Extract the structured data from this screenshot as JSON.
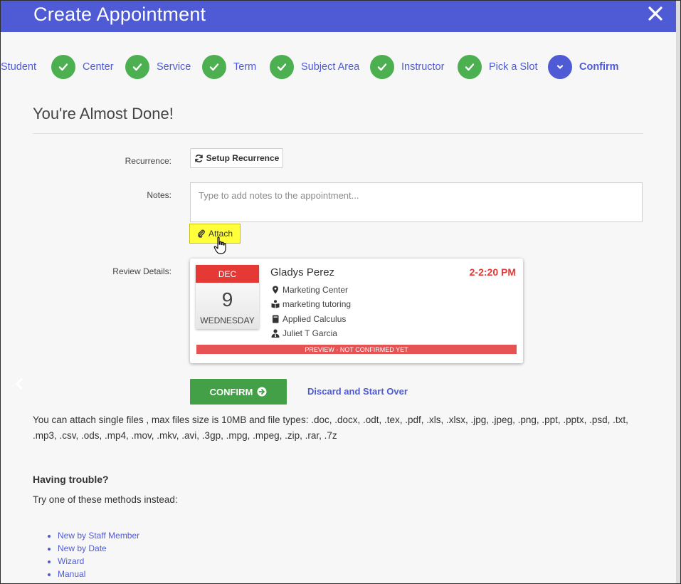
{
  "header": {
    "title": "Create Appointment"
  },
  "steps": [
    {
      "label": "Student",
      "done": true
    },
    {
      "label": "Center",
      "done": true
    },
    {
      "label": "Service",
      "done": true
    },
    {
      "label": "Term",
      "done": true
    },
    {
      "label": "Subject Area",
      "done": true
    },
    {
      "label": "Instructor",
      "done": true
    },
    {
      "label": "Pick a Slot",
      "done": true
    },
    {
      "label": "Confirm",
      "done": false,
      "active": true
    }
  ],
  "page_title": "You're Almost Done!",
  "form": {
    "recurrence_label": "Recurrence:",
    "recurrence_button": "Setup Recurrence",
    "notes_label": "Notes:",
    "notes_placeholder": "Type to add notes to the appointment...",
    "attach_button": "Attach",
    "review_label": "Review Details:"
  },
  "review": {
    "month": "DEC",
    "day": "9",
    "weekday": "WEDNESDAY",
    "name": "Gladys Perez",
    "time": "2-2:20 PM",
    "center": "Marketing Center",
    "service": "marketing tutoring",
    "subject": "Applied Calculus",
    "instructor": "Juliet T Garcia",
    "preview_text": "PREVIEW - NOT CONFIRMED YET"
  },
  "actions": {
    "confirm_label": "CONFIRM",
    "discard_label": "Discard and Start Over"
  },
  "info_text": "You can attach single files , max files size is 10MB and file types: .doc, .docx, .odt, .tex, .pdf, .xls, .xlsx, .jpg, .jpeg, .png, .ppt, .pptx, .psd, .txt, .mp3, .csv, .ods, .mp4, .mov, .mkv, .avi, .3gp, .mpg, .mpeg, .zip, .rar, .7z",
  "trouble": {
    "heading": "Having trouble?",
    "subtext": "Try one of these methods instead:",
    "methods": [
      "New by Staff Member",
      "New by Date",
      "Wizard",
      "Manual"
    ]
  },
  "colors": {
    "brand": "#4f5bd5",
    "success": "#4caf50",
    "danger": "#e53935",
    "highlight": "#ffff3b"
  }
}
